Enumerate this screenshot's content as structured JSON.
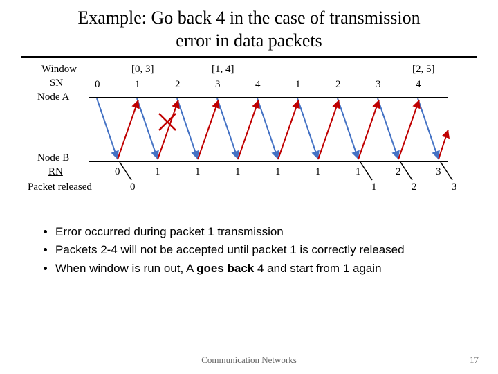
{
  "title_line1": "Example: Go back 4 in the case of transmission",
  "title_line2": "error in data packets",
  "labels": {
    "window": "Window",
    "sn": "SN",
    "nodeA": "Node A",
    "nodeB": "Node B",
    "rn": "RN",
    "packet_released": "Packet released"
  },
  "windows": [
    "[0, 3]",
    "[1, 4]",
    "[2, 5]"
  ],
  "sn_values": [
    "0",
    "1",
    "2",
    "3",
    "4",
    "1",
    "2",
    "3",
    "4"
  ],
  "rn_values": [
    "0",
    "1",
    "1",
    "1",
    "1",
    "1",
    "1",
    "2",
    "3"
  ],
  "released_values": [
    "0",
    "1",
    "2",
    "3"
  ],
  "bullets": [
    "Error occurred during packet 1 transmission",
    "Packets 2-4 will not be accepted until packet 1 is correctly released",
    {
      "pre": "When window is run out, A ",
      "bold": "goes back",
      "post": " 4 and start from 1 again"
    }
  ],
  "footer": "Communication Networks",
  "page": "17"
}
